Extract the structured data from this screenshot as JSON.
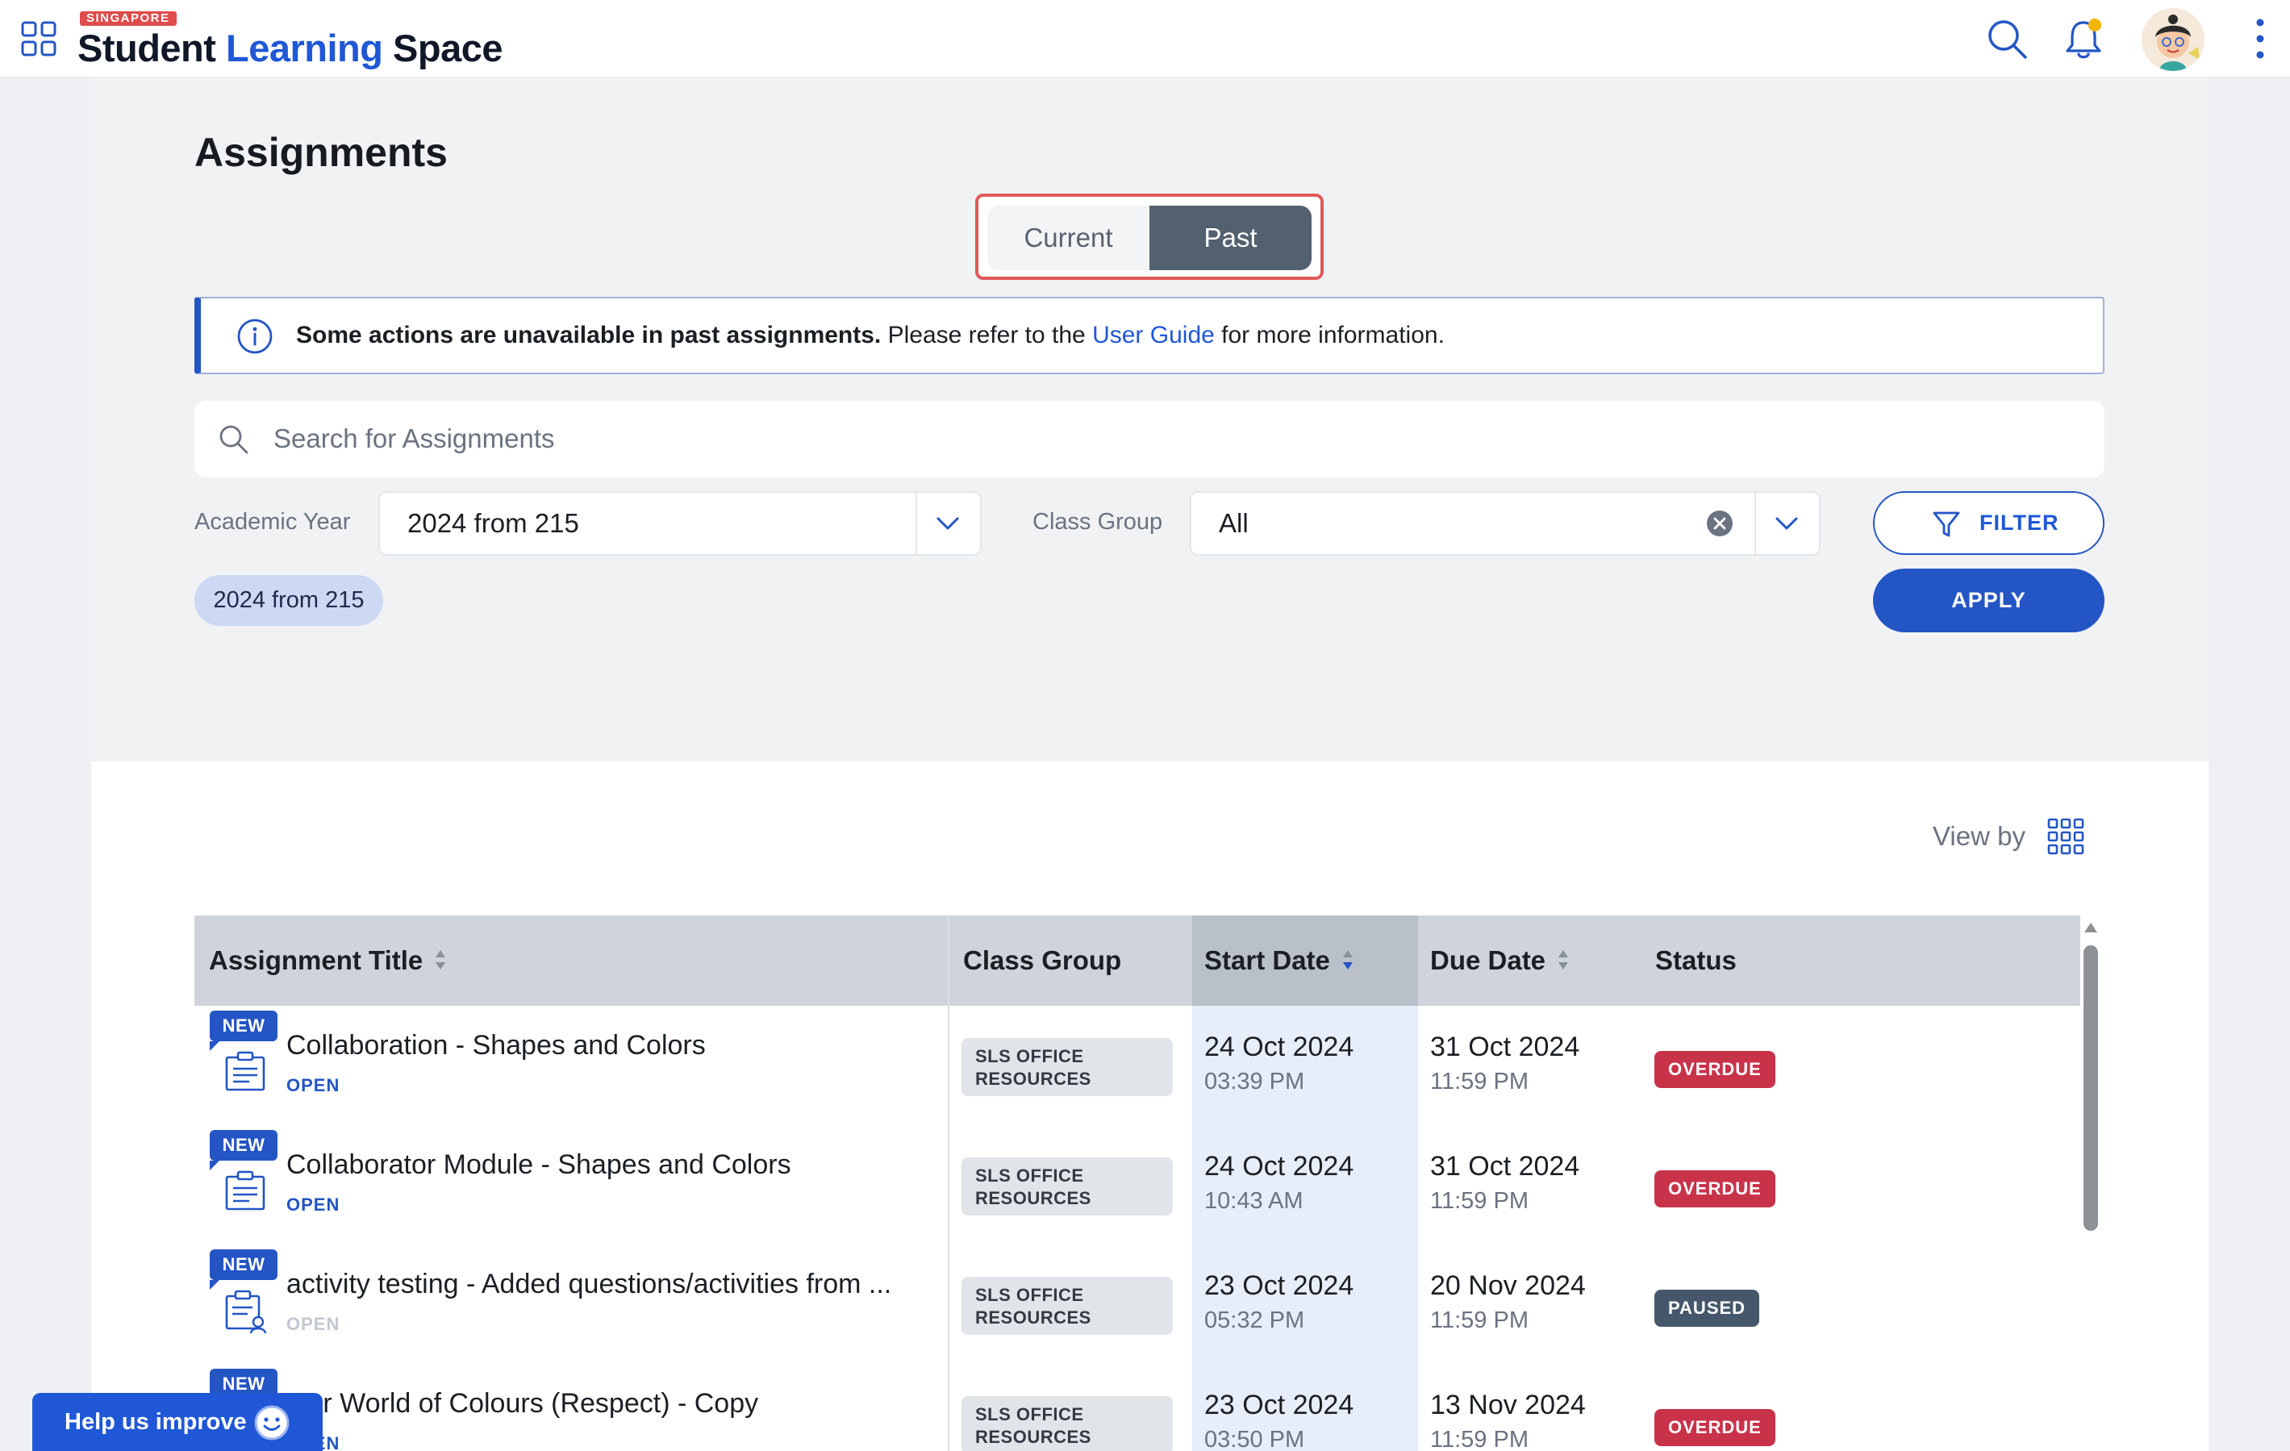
{
  "header": {
    "logo_tag": "SINGAPORE",
    "logo_part1": "Student",
    "logo_part2": "Learning",
    "logo_part3": "Space"
  },
  "page": {
    "title": "Assignments",
    "toggle": {
      "current": "Current",
      "past": "Past",
      "selected": "Past"
    }
  },
  "banner": {
    "bold": "Some actions are unavailable in past assignments.",
    "text_before_link": " Please refer to the ",
    "link": "User Guide",
    "text_after_link": " for more information."
  },
  "search": {
    "placeholder": "Search for Assignments"
  },
  "filters": {
    "academic_year_label": "Academic Year",
    "academic_year_value": "2024 from 215",
    "class_group_label": "Class Group",
    "class_group_value": "All",
    "chip": "2024 from 215",
    "filter_button": "FILTER",
    "apply_button": "APPLY"
  },
  "list": {
    "view_by": "View by",
    "columns": [
      "Assignment Title",
      "Class Group",
      "Start Date",
      "Due Date",
      "Status"
    ],
    "new_badge": "NEW",
    "rows": [
      {
        "title": "Collaboration - Shapes and Colors",
        "state": "OPEN",
        "class_group_l1": "SLS OFFICE",
        "class_group_l2": "RESOURCES",
        "start_date": "24 Oct 2024",
        "start_time": "03:39 PM",
        "due_date": "31 Oct 2024",
        "due_time": "11:59 PM",
        "status": "OVERDUE"
      },
      {
        "title": "Collaborator Module - Shapes and Colors",
        "state": "OPEN",
        "class_group_l1": "SLS OFFICE",
        "class_group_l2": "RESOURCES",
        "start_date": "24 Oct 2024",
        "start_time": "10:43 AM",
        "due_date": "31 Oct 2024",
        "due_time": "11:59 PM",
        "status": "OVERDUE"
      },
      {
        "title": "activity testing - Added questions/activities from ...",
        "state": "OPEN",
        "class_group_l1": "SLS OFFICE",
        "class_group_l2": "RESOURCES",
        "start_date": "23 Oct 2024",
        "start_time": "05:32 PM",
        "due_date": "20 Nov 2024",
        "due_time": "11:59 PM",
        "status": "PAUSED"
      },
      {
        "title": "Our World of Colours (Respect) - Copy",
        "state": "OPEN",
        "class_group_l1": "SLS OFFICE",
        "class_group_l2": "RESOURCES",
        "start_date": "23 Oct 2024",
        "start_time": "03:50 PM",
        "due_date": "13 Nov 2024",
        "due_time": "11:59 PM",
        "status": "OVERDUE"
      }
    ]
  },
  "help": {
    "label": "Help us improve"
  },
  "colors": {
    "brand_blue": "#1f57d6",
    "overdue": "#c9334a",
    "paused": "#46576b",
    "toggle_active": "#536070",
    "highlight_outline": "#e05a5a"
  }
}
